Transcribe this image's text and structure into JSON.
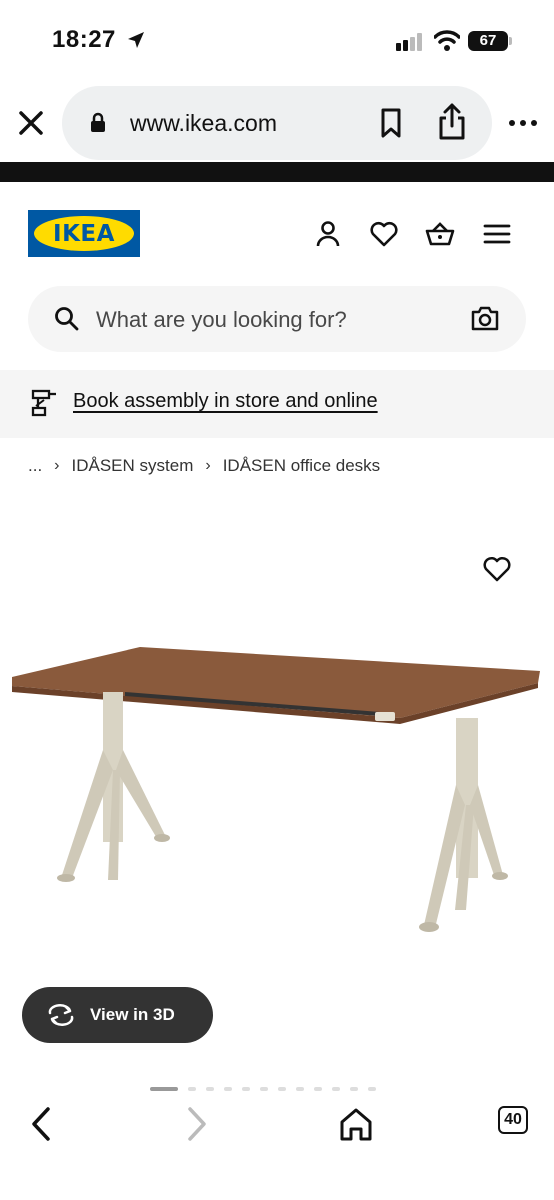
{
  "status_bar": {
    "time": "18:27",
    "battery": "67"
  },
  "browser": {
    "url": "www.ikea.com",
    "tab_count": "40"
  },
  "header": {
    "logo_text": "IKEA"
  },
  "search": {
    "placeholder": "What are you looking for?"
  },
  "banner": {
    "link_text": "Book assembly in store and online"
  },
  "breadcrumb": {
    "ellipsis": "...",
    "items": [
      "IDÅSEN system",
      "IDÅSEN office desks"
    ]
  },
  "product": {
    "view_3d_label": "View in 3D"
  },
  "colors": {
    "ikea_blue": "#0058a3",
    "ikea_yellow": "#ffdb00",
    "desk_top": "#8a5a3c",
    "desk_legs": "#d9d4c4"
  }
}
